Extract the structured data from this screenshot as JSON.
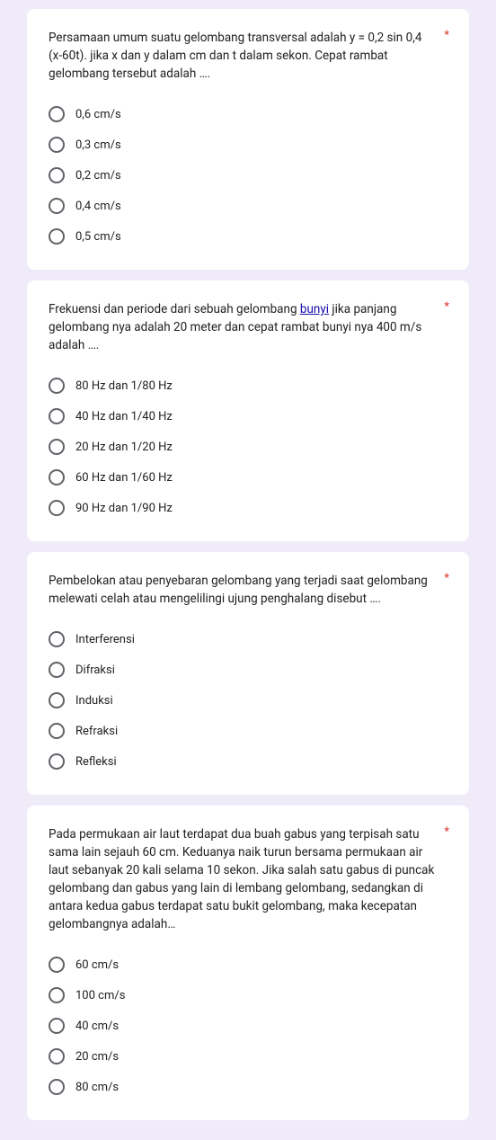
{
  "questions": [
    {
      "text_before": "Persamaan umum suatu gelombang transversal adalah y = 0,2 sin 0,4  (x-60t). jika x dan y dalam cm dan t dalam sekon. Cepat rambat gelombang tersebut adalah ….",
      "link": "",
      "text_after": "",
      "required": "*",
      "options": [
        "0,6 cm/s",
        "0,3 cm/s",
        "0,2 cm/s",
        "0,4 cm/s",
        "0,5 cm/s"
      ]
    },
    {
      "text_before": "Frekuensi dan periode dari sebuah gelombang ",
      "link": "bunyi",
      "text_after": " jika panjang gelombang nya adalah 20 meter dan cepat rambat bunyi nya 400 m/s adalah ….",
      "required": "*",
      "options": [
        "80 Hz dan 1/80 Hz",
        "40 Hz dan 1/40 Hz",
        "20 Hz dan 1/20 Hz",
        "60 Hz dan 1/60 Hz",
        "90 Hz dan 1/90 Hz"
      ]
    },
    {
      "text_before": "Pembelokan atau penyebaran gelombang yang terjadi saat gelombang melewati celah atau mengelilingi ujung penghalang disebut ….",
      "link": "",
      "text_after": "",
      "required": "*",
      "options": [
        "Interferensi",
        "Difraksi",
        "Induksi",
        "Refraksi",
        "Refleksi"
      ]
    },
    {
      "text_before": "Pada permukaan air laut terdapat dua buah gabus yang terpisah satu sama lain sejauh 60 cm. Keduanya naik turun bersama permukaan air laut sebanyak 20 kali selama 10 sekon. Jika salah satu gabus di puncak gelombang dan gabus yang lain di lembang gelombang, sedangkan di antara kedua gabus terdapat satu bukit gelombang, maka kecepatan gelombangnya adalah…",
      "link": "",
      "text_after": "",
      "required": "*",
      "options": [
        "60 cm/s",
        "100 cm/s",
        "40 cm/s",
        "20 cm/s",
        "80 cm/s"
      ]
    }
  ]
}
